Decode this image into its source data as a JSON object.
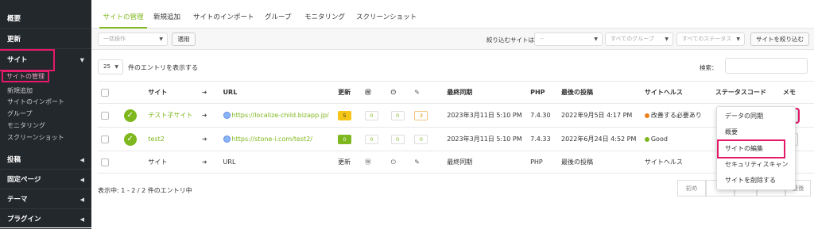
{
  "sidebar": {
    "items": [
      {
        "label": "概要"
      },
      {
        "label": "更新"
      },
      {
        "label": "サイト"
      },
      {
        "label": "投稿"
      },
      {
        "label": "固定ページ"
      },
      {
        "label": "テーマ"
      },
      {
        "label": "プラグイン"
      }
    ],
    "sub": [
      "サイトの管理",
      "新規追加",
      "サイトのインポート",
      "グループ",
      "モニタリング",
      "スクリーンショット"
    ]
  },
  "tabs": [
    "サイトの管理",
    "新規追加",
    "サイトのインポート",
    "グループ",
    "モニタリング",
    "スクリーンショット"
  ],
  "toolbar": {
    "bulk_placeholder": "一括操作",
    "apply": "適用",
    "filter_label": "絞り込むサイトは：",
    "filter_site": "--",
    "filter_group": "すべてのグループ",
    "filter_status": "すべてのステータス",
    "filter_button": "サイトを絞り込む"
  },
  "entries": {
    "count": "25",
    "suffix": "件のエントリを表示する",
    "search_label": "検索："
  },
  "columns": [
    "サイト",
    "URL",
    "更新",
    "最終同期",
    "PHP",
    "最後の投稿",
    "サイトヘルス",
    "ステータスコード",
    "メモ"
  ],
  "rows": [
    {
      "site": "テスト子サイト",
      "url": "https://localize-child.bizapp.jp/",
      "updates": "5",
      "wp": "0",
      "plugin": "0",
      "theme": "3",
      "sync": "2023年3月11日 5:10 PM",
      "php": "7.4.30",
      "post": "2022年9月5日 4:17 PM",
      "health": "改善する必要あり",
      "health_color": "#f0821e"
    },
    {
      "site": "test2",
      "url": "https://stone-i.com/test2/",
      "updates": "0",
      "wp": "0",
      "plugin": "0",
      "theme": "0",
      "sync": "2023年3月11日 5:10 PM",
      "php": "7.4.33",
      "post": "2022年6月24日 4:52 PM",
      "health": "Good",
      "health_color": "#7fb71e"
    }
  ],
  "status_check": "✓",
  "row_actions": "···",
  "footer_info": "表示中: 1 - 2 / 2 件のエントリ中",
  "menu": [
    "データの同期",
    "概要",
    "サイトの編集",
    "セキュリティスキャン",
    "サイトを削除する"
  ],
  "pager": {
    "first": "初め",
    "last": "最後"
  },
  "colors": {
    "accent": "#7fb71e",
    "highlight": "#e5196a",
    "sidebar": "#23282d"
  }
}
